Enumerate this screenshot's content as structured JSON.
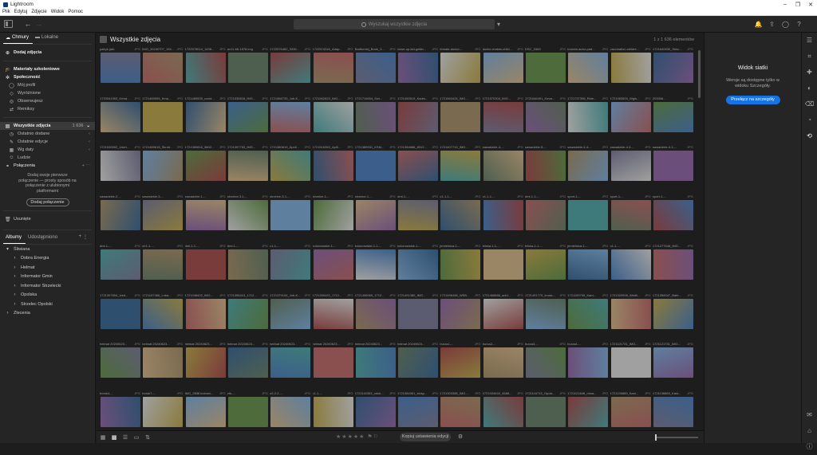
{
  "window": {
    "title": "Lightroom"
  },
  "menu": [
    "Plik",
    "Edytuj",
    "Zdjęcie",
    "Widok",
    "Pomoc"
  ],
  "search": {
    "placeholder": "Wyszukaj wszystkie zdjęcia"
  },
  "left": {
    "tabs": [
      {
        "label": "Chmury"
      },
      {
        "label": "Lokalne"
      }
    ],
    "add_photos": "Dodaj zdjęcia",
    "learn": "Materiały szkoleniowe",
    "community": "Społeczność",
    "community_items": [
      "Mój profil",
      "Wyróżnione",
      "Obserwujesz",
      "Remiksy"
    ],
    "all_photos": "Wszystkie zdjęcia",
    "all_photos_count": "1 636",
    "all_items": [
      "Ostatnio dodane",
      "Ostatnie edycje",
      "Wg daty",
      "Ludzie"
    ],
    "connections": "Połączenia",
    "connections_hint": "Dodaj swoje pierwsze połączenie — prosty sposób na połączenie z ulubionymi platformami",
    "add_connection": "Dodaj połączenie",
    "deleted": "Usunięte",
    "album_tabs": [
      "Albumy",
      "Udostępniono"
    ],
    "albums": [
      {
        "label": "Śliwiana",
        "level": 0,
        "arrow": "▾"
      },
      {
        "label": "Dobra Energia",
        "level": 1,
        "arrow": "›"
      },
      {
        "label": "Helmat",
        "level": 1,
        "arrow": "›"
      },
      {
        "label": "Informator Gmin",
        "level": 1,
        "arrow": "›"
      },
      {
        "label": "Informator Strzelecki",
        "level": 1,
        "arrow": "›"
      },
      {
        "label": "Opolska",
        "level": 1,
        "arrow": "›"
      },
      {
        "label": "Strzelec Opolski",
        "level": 1,
        "arrow": "›"
      },
      {
        "label": "Zlecenia",
        "level": 0,
        "arrow": "›"
      }
    ]
  },
  "main": {
    "title": "Wszystkie zdjęcia",
    "count": "1 z 1 636 elementów",
    "rows": [
      [
        "patryk jaki-",
        "IMG_20240707_154...",
        "1722578014_1496...",
        "av11-66-1878.img",
        "1722576482_3336...",
        "1722574316_Adap...",
        "Bartłomiej_Bonk_3...",
        "close-up-kid-gettin...",
        "female-doctor-...",
        "doctor-makes-child...",
        "DSC_3363",
        "bronda-autor-pad...",
        "vaccination-childre...",
        "1721640830_Sekc..."
      ],
      [
        "1720541553_Kmwi...",
        "1721489555_Kma...",
        "1721489535_covid...",
        "1721535818_IMG...",
        "1721566739_Job-K...",
        "1721562623_IMG...",
        "1721710654_Swi...",
        "1721450519_Kadrs...",
        "1721563424_IMG...",
        "1721570304_IMG...",
        "1721646491_Kmar...",
        "1721737396_Ride...",
        "1721983500_Wgls...",
        "203306...",
        "8253265_92356..."
      ],
      [
        "1721535592_Ustel...",
        "1721489618_Skrob...",
        "1721380816_5802...",
        "1721397763_IMG...",
        "1721380819_Apoll...",
        "1721516353_Apill...",
        "1721389931_KSM...",
        "1721384886_8312...",
        "1721407719_IMG...",
        "sawadzkie-4-...",
        "sawadzkie-5-...",
        "sawadzkie-4-4-...",
        "sawadzkie-4-3-...",
        "sawadzkie-4-1-..."
      ],
      [
        "sawadzkie-2-...",
        "sawadzkie-3-...",
        "sawadzkie-1-...",
        "strzelce-3-1-...",
        "strzelce-3-1-...",
        "strzelce-1-...",
        "strzelce-1-...",
        "dml-1-...",
        "c1-1-1-...",
        "c1-1-1-...",
        "dml-1-1-...",
        "sport-1-...",
        "sport-1-...",
        "sport-1-..."
      ],
      [
        "dml-1-...",
        "ch1-1-...",
        "dml-1-1-...",
        "dml-1-...",
        "c1-1-...",
        "kolonowskie-1-...",
        "kolonowskie-1-1-...",
        "kolonowskie-1-...",
        "jemielnica-1-...",
        "bliska-1-1-...",
        "bliska-1-1-...",
        "jemielnica-1-...",
        "c1-1-...",
        "1721277648_IMG..."
      ],
      [
        "1721397654_Ized...",
        "1721197466_Loka...",
        "1721048422_IMG...",
        "1721396413_1712...",
        "1721379154_Job-K...",
        "1721390420_1712...",
        "1721406965_1712...",
        "1721491380_IMG...",
        "1721496456_WEB...",
        "1721468886_adr1...",
        "1721491775_kruda...",
        "1721159799_Kam...",
        "1721320995_Wedli...",
        "1721356047_Bafe...",
        "1721356050_Lah..."
      ],
      [
        "helmat 20240623...",
        "helmat 20240623...",
        "helmat 20240623...",
        "helmat 20240623...",
        "helmat 20240623...",
        "helmat 20240623...",
        "helmat 20240623...",
        "helmat 20240623...",
        "burza1-...",
        "burza2-...",
        "burza3-...",
        "burza4-...",
        "1721121731_IMG...",
        "1721121731_IMG..."
      ],
      [
        "borsk4-...",
        "borsk7-...",
        "IMG_2836 kolorwi...",
        "ztk-...",
        "z2-2-2-...",
        "c1-1-...",
        "1721116353_oduk...",
        "1721384361_kinsp...",
        "1721303385_IMG...",
        "1721034640_4588...",
        "1721116713_Opols...",
        "1721121648_mina...",
        "1721136869_Kast...",
        "1721136869_Kast..."
      ]
    ]
  },
  "bottom": {
    "copy_settings": "Kopiuj ustawienia edycji"
  },
  "right": {
    "title": "Widok siatki",
    "text": "Wersje są dostępne tylko w widoku Szczegóły.",
    "button": "Przełącz na szczegóły"
  },
  "colors": {
    "accent": "#1473e6",
    "bg": "#1d1d1d",
    "panel": "#252525"
  }
}
